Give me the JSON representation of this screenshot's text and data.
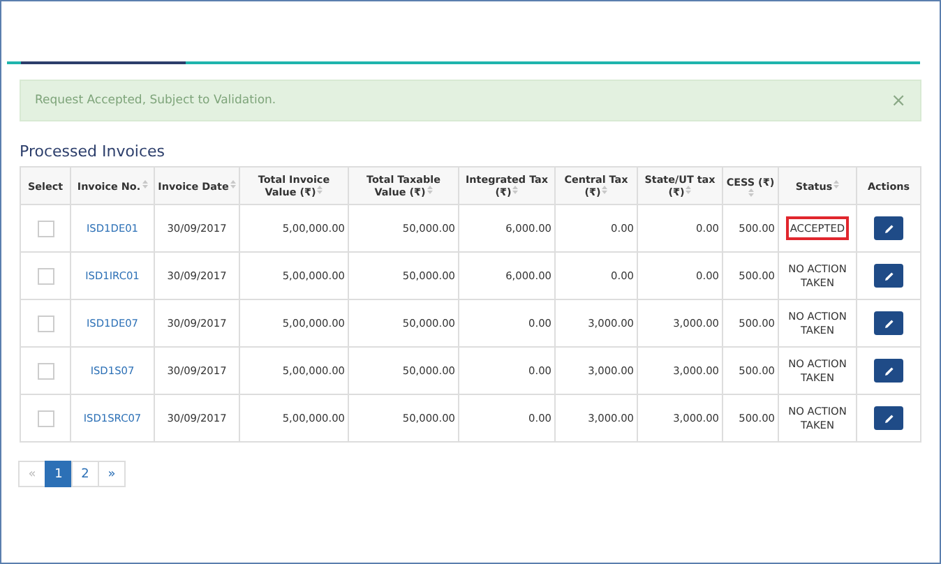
{
  "alert": {
    "message": "Request Accepted, Subject to Validation.",
    "close": "×"
  },
  "section_title": "Processed Invoices",
  "table": {
    "columns": [
      {
        "label": "Select",
        "sortable": false
      },
      {
        "label": "Invoice No.",
        "sortable": true
      },
      {
        "label": "Invoice Date",
        "sortable": true
      },
      {
        "label": "Total Invoice Value (₹)",
        "sortable": true
      },
      {
        "label": "Total Taxable Value (₹)",
        "sortable": true
      },
      {
        "label": "Integrated Tax (₹)",
        "sortable": true
      },
      {
        "label": "Central Tax (₹)",
        "sortable": true
      },
      {
        "label": "State/UT tax (₹)",
        "sortable": true
      },
      {
        "label": "CESS (₹)",
        "sortable": true
      },
      {
        "label": "Status",
        "sortable": true
      },
      {
        "label": "Actions",
        "sortable": false
      }
    ],
    "rows": [
      {
        "checked": false,
        "invoice_no": "ISD1DE01",
        "date": "30/09/2017",
        "total_invoice": "5,00,000.00",
        "total_taxable": "50,000.00",
        "integrated": "6,000.00",
        "central": "0.00",
        "state": "0.00",
        "cess": "500.00",
        "status": "ACCEPTED",
        "highlighted": true
      },
      {
        "checked": false,
        "invoice_no": "ISD1IRC01",
        "date": "30/09/2017",
        "total_invoice": "5,00,000.00",
        "total_taxable": "50,000.00",
        "integrated": "6,000.00",
        "central": "0.00",
        "state": "0.00",
        "cess": "500.00",
        "status": "NO ACTION TAKEN",
        "highlighted": false
      },
      {
        "checked": false,
        "invoice_no": "ISD1DE07",
        "date": "30/09/2017",
        "total_invoice": "5,00,000.00",
        "total_taxable": "50,000.00",
        "integrated": "0.00",
        "central": "3,000.00",
        "state": "3,000.00",
        "cess": "500.00",
        "status": "NO ACTION TAKEN",
        "highlighted": false
      },
      {
        "checked": false,
        "invoice_no": "ISD1S07",
        "date": "30/09/2017",
        "total_invoice": "5,00,000.00",
        "total_taxable": "50,000.00",
        "integrated": "0.00",
        "central": "3,000.00",
        "state": "3,000.00",
        "cess": "500.00",
        "status": "NO ACTION TAKEN",
        "highlighted": false
      },
      {
        "checked": false,
        "invoice_no": "ISD1SRC07",
        "date": "30/09/2017",
        "total_invoice": "5,00,000.00",
        "total_taxable": "50,000.00",
        "integrated": "0.00",
        "central": "3,000.00",
        "state": "3,000.00",
        "cess": "500.00",
        "status": "NO ACTION TAKEN",
        "highlighted": false
      }
    ]
  },
  "pagination": {
    "previous": {
      "label": "«",
      "disabled": true
    },
    "pages": [
      {
        "label": "1",
        "selected": true
      },
      {
        "label": "2",
        "selected": false
      }
    ],
    "next": {
      "label": "»",
      "disabled": false
    }
  }
}
